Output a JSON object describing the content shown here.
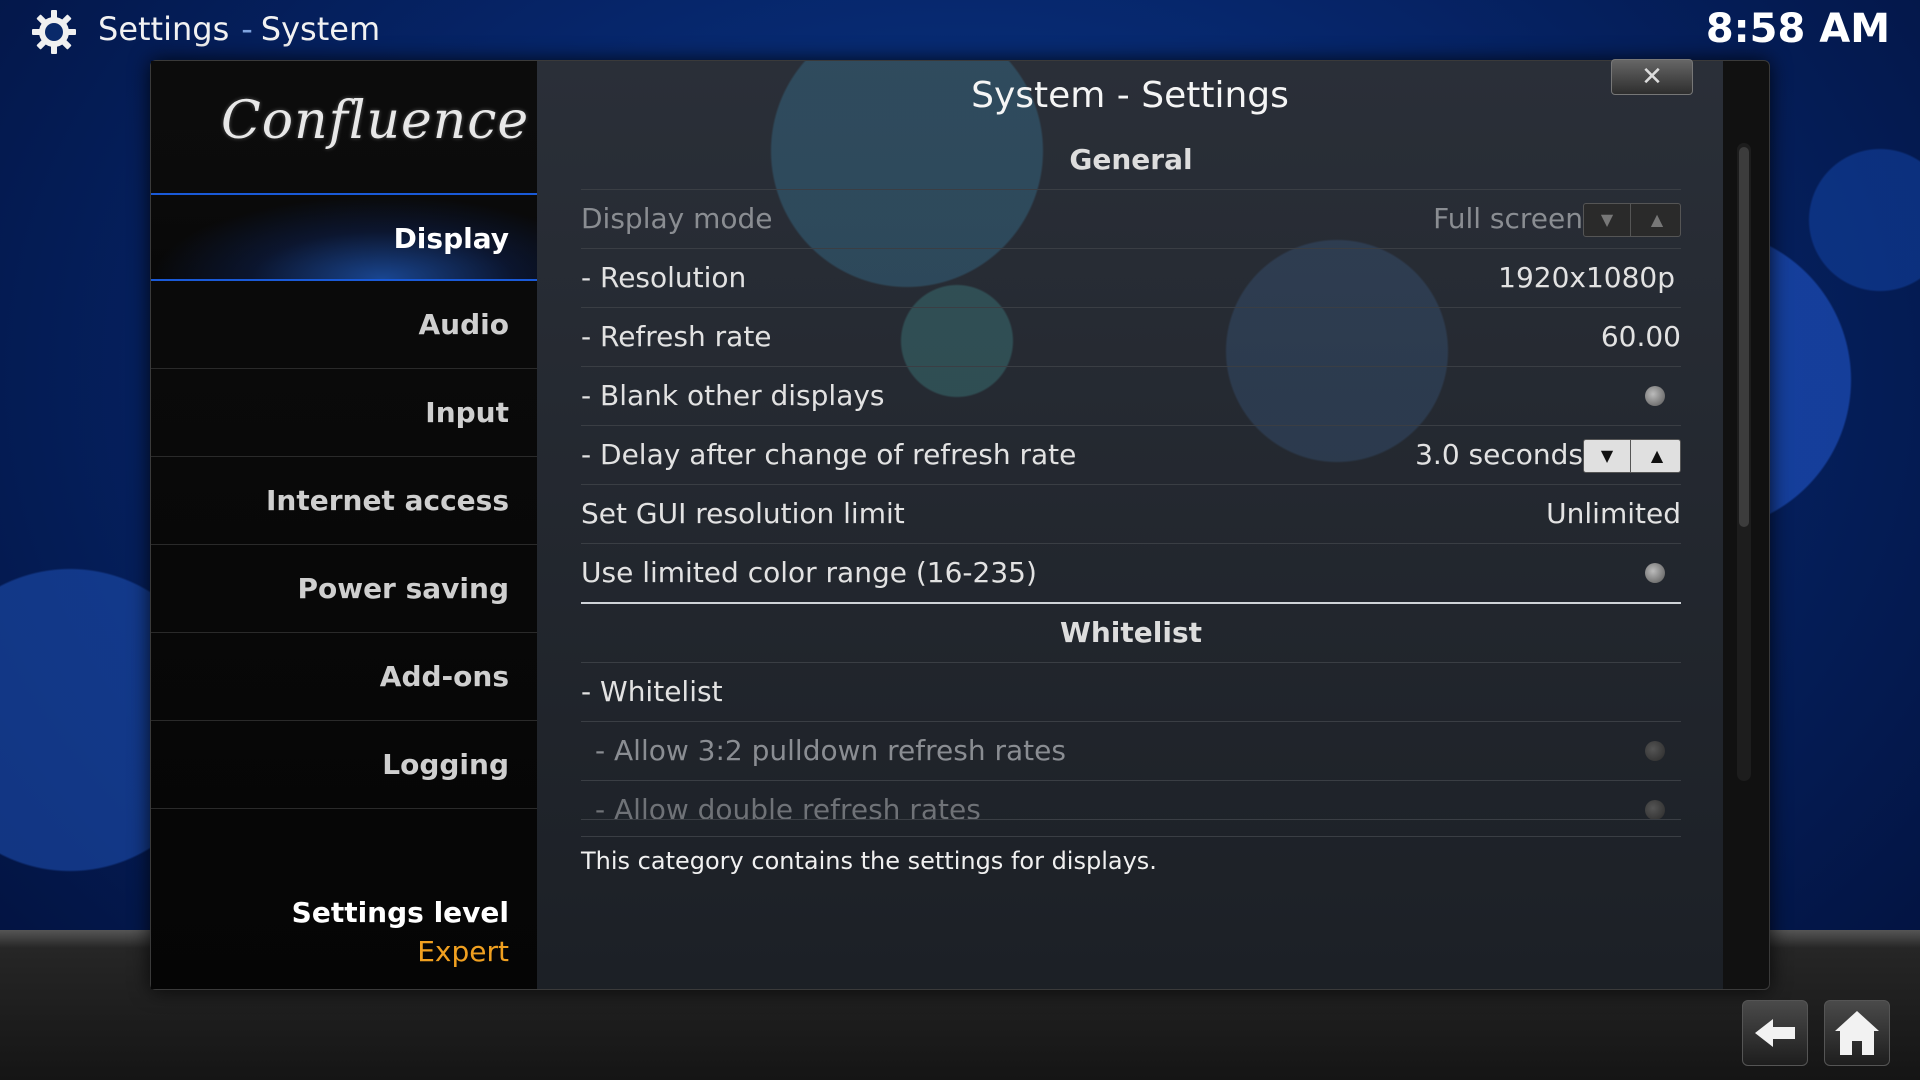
{
  "header": {
    "section": "Settings",
    "separator": "-",
    "page": "System",
    "time": "8:58 AM",
    "icon": "gear-icon"
  },
  "dialog": {
    "title": "System - Settings",
    "close_label": "✕",
    "logo": "Confluence"
  },
  "sidebar": {
    "items": [
      {
        "label": "Display",
        "active": true
      },
      {
        "label": "Audio"
      },
      {
        "label": "Input"
      },
      {
        "label": "Internet access"
      },
      {
        "label": "Power saving"
      },
      {
        "label": "Add-ons"
      },
      {
        "label": "Logging"
      }
    ],
    "settings_level_label": "Settings level",
    "settings_level_value": "Expert"
  },
  "settings": {
    "general_header": "General",
    "display_mode": {
      "label": "Display mode",
      "value": "Full screen"
    },
    "resolution": {
      "label": "- Resolution",
      "value": "1920x1080p"
    },
    "refresh_rate": {
      "label": "- Refresh rate",
      "value": "60.00"
    },
    "blank_other": {
      "label": "- Blank other displays"
    },
    "delay_refresh": {
      "label": "- Delay after change of refresh rate",
      "value": "3.0 seconds"
    },
    "gui_limit": {
      "label": "Set GUI resolution limit",
      "value": "Unlimited"
    },
    "limited_color": {
      "label": "Use limited color range (16-235)"
    },
    "whitelist_header": "Whitelist",
    "whitelist": {
      "label": "- Whitelist"
    },
    "pulldown": {
      "label": "- Allow 3:2 pulldown refresh rates"
    },
    "double_rates": {
      "label": "- Allow double refresh rates"
    }
  },
  "description": "This category contains the settings for displays.",
  "colors": {
    "accent": "#1a5ad8",
    "expert": "#f0a020"
  },
  "footer": {
    "back_icon": "back-arrow-icon",
    "home_icon": "home-icon"
  }
}
